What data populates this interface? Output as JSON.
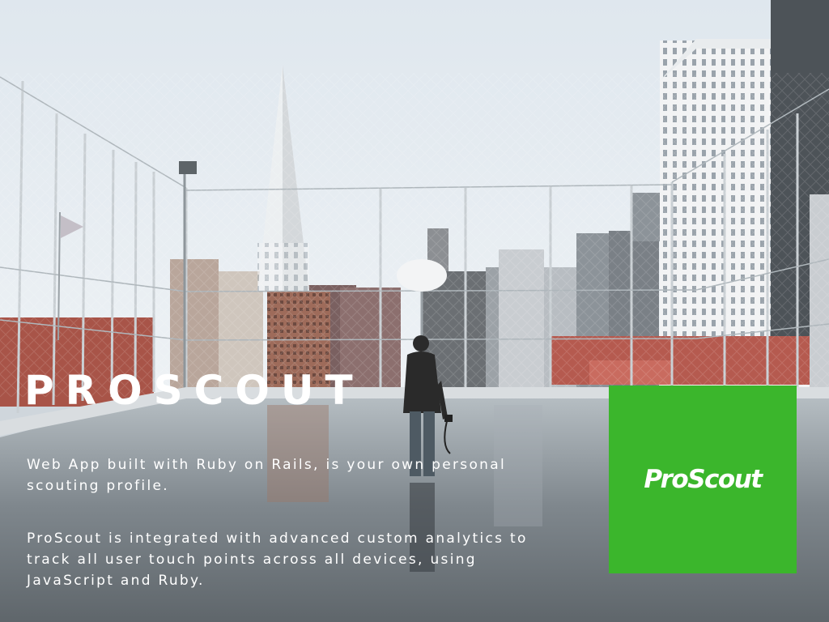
{
  "hero": {
    "title": "PROSCOUT",
    "description_1": "Web App built with Ruby on Rails, is your own personal scouting profile.",
    "description_2": "ProScout is integrated with advanced custom analytics to track all user touch points across all devices, using JavaScript and Ruby."
  },
  "logo": {
    "text": "ProScout",
    "background": "#3bb62c"
  }
}
